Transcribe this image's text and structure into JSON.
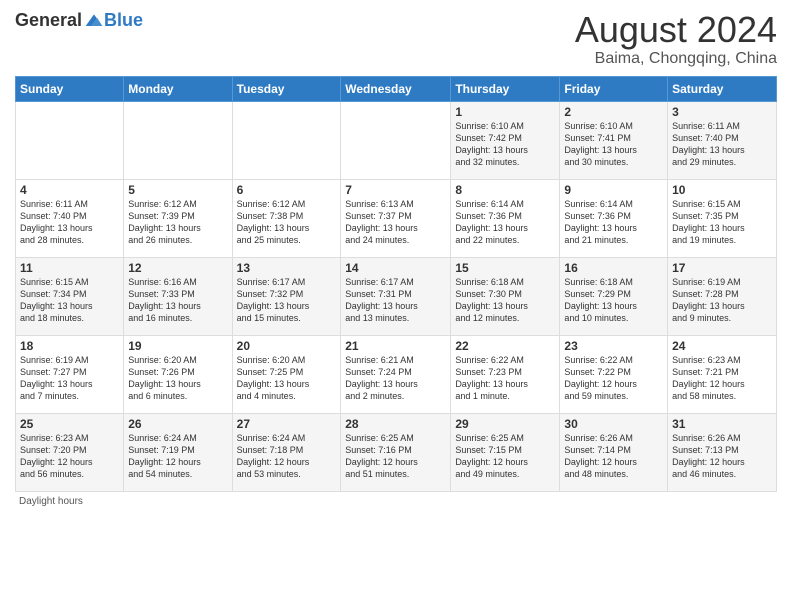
{
  "header": {
    "logo": {
      "general": "General",
      "blue": "Blue"
    },
    "title": "August 2024",
    "location": "Baima, Chongqing, China"
  },
  "weekdays": [
    "Sunday",
    "Monday",
    "Tuesday",
    "Wednesday",
    "Thursday",
    "Friday",
    "Saturday"
  ],
  "weeks": [
    [
      {
        "day": "",
        "info": ""
      },
      {
        "day": "",
        "info": ""
      },
      {
        "day": "",
        "info": ""
      },
      {
        "day": "",
        "info": ""
      },
      {
        "day": "1",
        "info": "Sunrise: 6:10 AM\nSunset: 7:42 PM\nDaylight: 13 hours\nand 32 minutes."
      },
      {
        "day": "2",
        "info": "Sunrise: 6:10 AM\nSunset: 7:41 PM\nDaylight: 13 hours\nand 30 minutes."
      },
      {
        "day": "3",
        "info": "Sunrise: 6:11 AM\nSunset: 7:40 PM\nDaylight: 13 hours\nand 29 minutes."
      }
    ],
    [
      {
        "day": "4",
        "info": "Sunrise: 6:11 AM\nSunset: 7:40 PM\nDaylight: 13 hours\nand 28 minutes."
      },
      {
        "day": "5",
        "info": "Sunrise: 6:12 AM\nSunset: 7:39 PM\nDaylight: 13 hours\nand 26 minutes."
      },
      {
        "day": "6",
        "info": "Sunrise: 6:12 AM\nSunset: 7:38 PM\nDaylight: 13 hours\nand 25 minutes."
      },
      {
        "day": "7",
        "info": "Sunrise: 6:13 AM\nSunset: 7:37 PM\nDaylight: 13 hours\nand 24 minutes."
      },
      {
        "day": "8",
        "info": "Sunrise: 6:14 AM\nSunset: 7:36 PM\nDaylight: 13 hours\nand 22 minutes."
      },
      {
        "day": "9",
        "info": "Sunrise: 6:14 AM\nSunset: 7:36 PM\nDaylight: 13 hours\nand 21 minutes."
      },
      {
        "day": "10",
        "info": "Sunrise: 6:15 AM\nSunset: 7:35 PM\nDaylight: 13 hours\nand 19 minutes."
      }
    ],
    [
      {
        "day": "11",
        "info": "Sunrise: 6:15 AM\nSunset: 7:34 PM\nDaylight: 13 hours\nand 18 minutes."
      },
      {
        "day": "12",
        "info": "Sunrise: 6:16 AM\nSunset: 7:33 PM\nDaylight: 13 hours\nand 16 minutes."
      },
      {
        "day": "13",
        "info": "Sunrise: 6:17 AM\nSunset: 7:32 PM\nDaylight: 13 hours\nand 15 minutes."
      },
      {
        "day": "14",
        "info": "Sunrise: 6:17 AM\nSunset: 7:31 PM\nDaylight: 13 hours\nand 13 minutes."
      },
      {
        "day": "15",
        "info": "Sunrise: 6:18 AM\nSunset: 7:30 PM\nDaylight: 13 hours\nand 12 minutes."
      },
      {
        "day": "16",
        "info": "Sunrise: 6:18 AM\nSunset: 7:29 PM\nDaylight: 13 hours\nand 10 minutes."
      },
      {
        "day": "17",
        "info": "Sunrise: 6:19 AM\nSunset: 7:28 PM\nDaylight: 13 hours\nand 9 minutes."
      }
    ],
    [
      {
        "day": "18",
        "info": "Sunrise: 6:19 AM\nSunset: 7:27 PM\nDaylight: 13 hours\nand 7 minutes."
      },
      {
        "day": "19",
        "info": "Sunrise: 6:20 AM\nSunset: 7:26 PM\nDaylight: 13 hours\nand 6 minutes."
      },
      {
        "day": "20",
        "info": "Sunrise: 6:20 AM\nSunset: 7:25 PM\nDaylight: 13 hours\nand 4 minutes."
      },
      {
        "day": "21",
        "info": "Sunrise: 6:21 AM\nSunset: 7:24 PM\nDaylight: 13 hours\nand 2 minutes."
      },
      {
        "day": "22",
        "info": "Sunrise: 6:22 AM\nSunset: 7:23 PM\nDaylight: 13 hours\nand 1 minute."
      },
      {
        "day": "23",
        "info": "Sunrise: 6:22 AM\nSunset: 7:22 PM\nDaylight: 12 hours\nand 59 minutes."
      },
      {
        "day": "24",
        "info": "Sunrise: 6:23 AM\nSunset: 7:21 PM\nDaylight: 12 hours\nand 58 minutes."
      }
    ],
    [
      {
        "day": "25",
        "info": "Sunrise: 6:23 AM\nSunset: 7:20 PM\nDaylight: 12 hours\nand 56 minutes."
      },
      {
        "day": "26",
        "info": "Sunrise: 6:24 AM\nSunset: 7:19 PM\nDaylight: 12 hours\nand 54 minutes."
      },
      {
        "day": "27",
        "info": "Sunrise: 6:24 AM\nSunset: 7:18 PM\nDaylight: 12 hours\nand 53 minutes."
      },
      {
        "day": "28",
        "info": "Sunrise: 6:25 AM\nSunset: 7:16 PM\nDaylight: 12 hours\nand 51 minutes."
      },
      {
        "day": "29",
        "info": "Sunrise: 6:25 AM\nSunset: 7:15 PM\nDaylight: 12 hours\nand 49 minutes."
      },
      {
        "day": "30",
        "info": "Sunrise: 6:26 AM\nSunset: 7:14 PM\nDaylight: 12 hours\nand 48 minutes."
      },
      {
        "day": "31",
        "info": "Sunrise: 6:26 AM\nSunset: 7:13 PM\nDaylight: 12 hours\nand 46 minutes."
      }
    ]
  ],
  "footer": {
    "daylight_label": "Daylight hours"
  }
}
